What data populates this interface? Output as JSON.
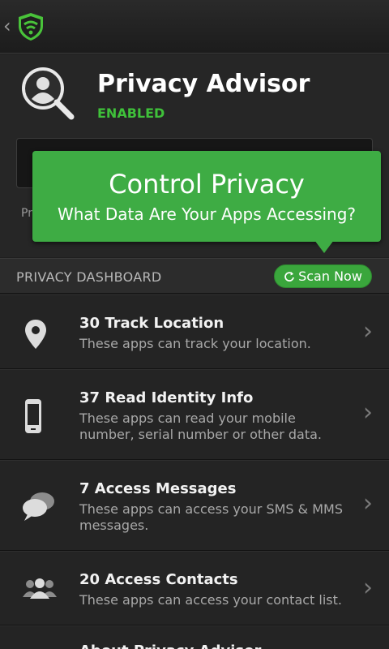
{
  "header": {
    "title": "Privacy Advisor",
    "status": "ENABLED",
    "partial_text": "Pr"
  },
  "tooltip": {
    "title": "Control Privacy",
    "subtitle": "What Data Are Your Apps Accessing?"
  },
  "dashboard": {
    "title": "PRIVACY DASHBOARD",
    "scan_label": "Scan Now"
  },
  "items": [
    {
      "title": "30 Track Location",
      "desc": "These apps can track your location.",
      "icon": "location-pin-icon"
    },
    {
      "title": "37 Read Identity Info",
      "desc": "These apps can read your mobile number, serial number or other data.",
      "icon": "phone-icon"
    },
    {
      "title": "7 Access Messages",
      "desc": "These apps can access your SMS & MMS messages.",
      "icon": "chat-bubbles-icon"
    },
    {
      "title": "20 Access Contacts",
      "desc": "These apps can access your contact list.",
      "icon": "contacts-icon"
    },
    {
      "title": "About Privacy Advisor",
      "desc": "",
      "icon": ""
    }
  ],
  "colors": {
    "accent_green": "#3fc13a",
    "tooltip_green": "#3eac44",
    "background": "#1f1f1f"
  }
}
